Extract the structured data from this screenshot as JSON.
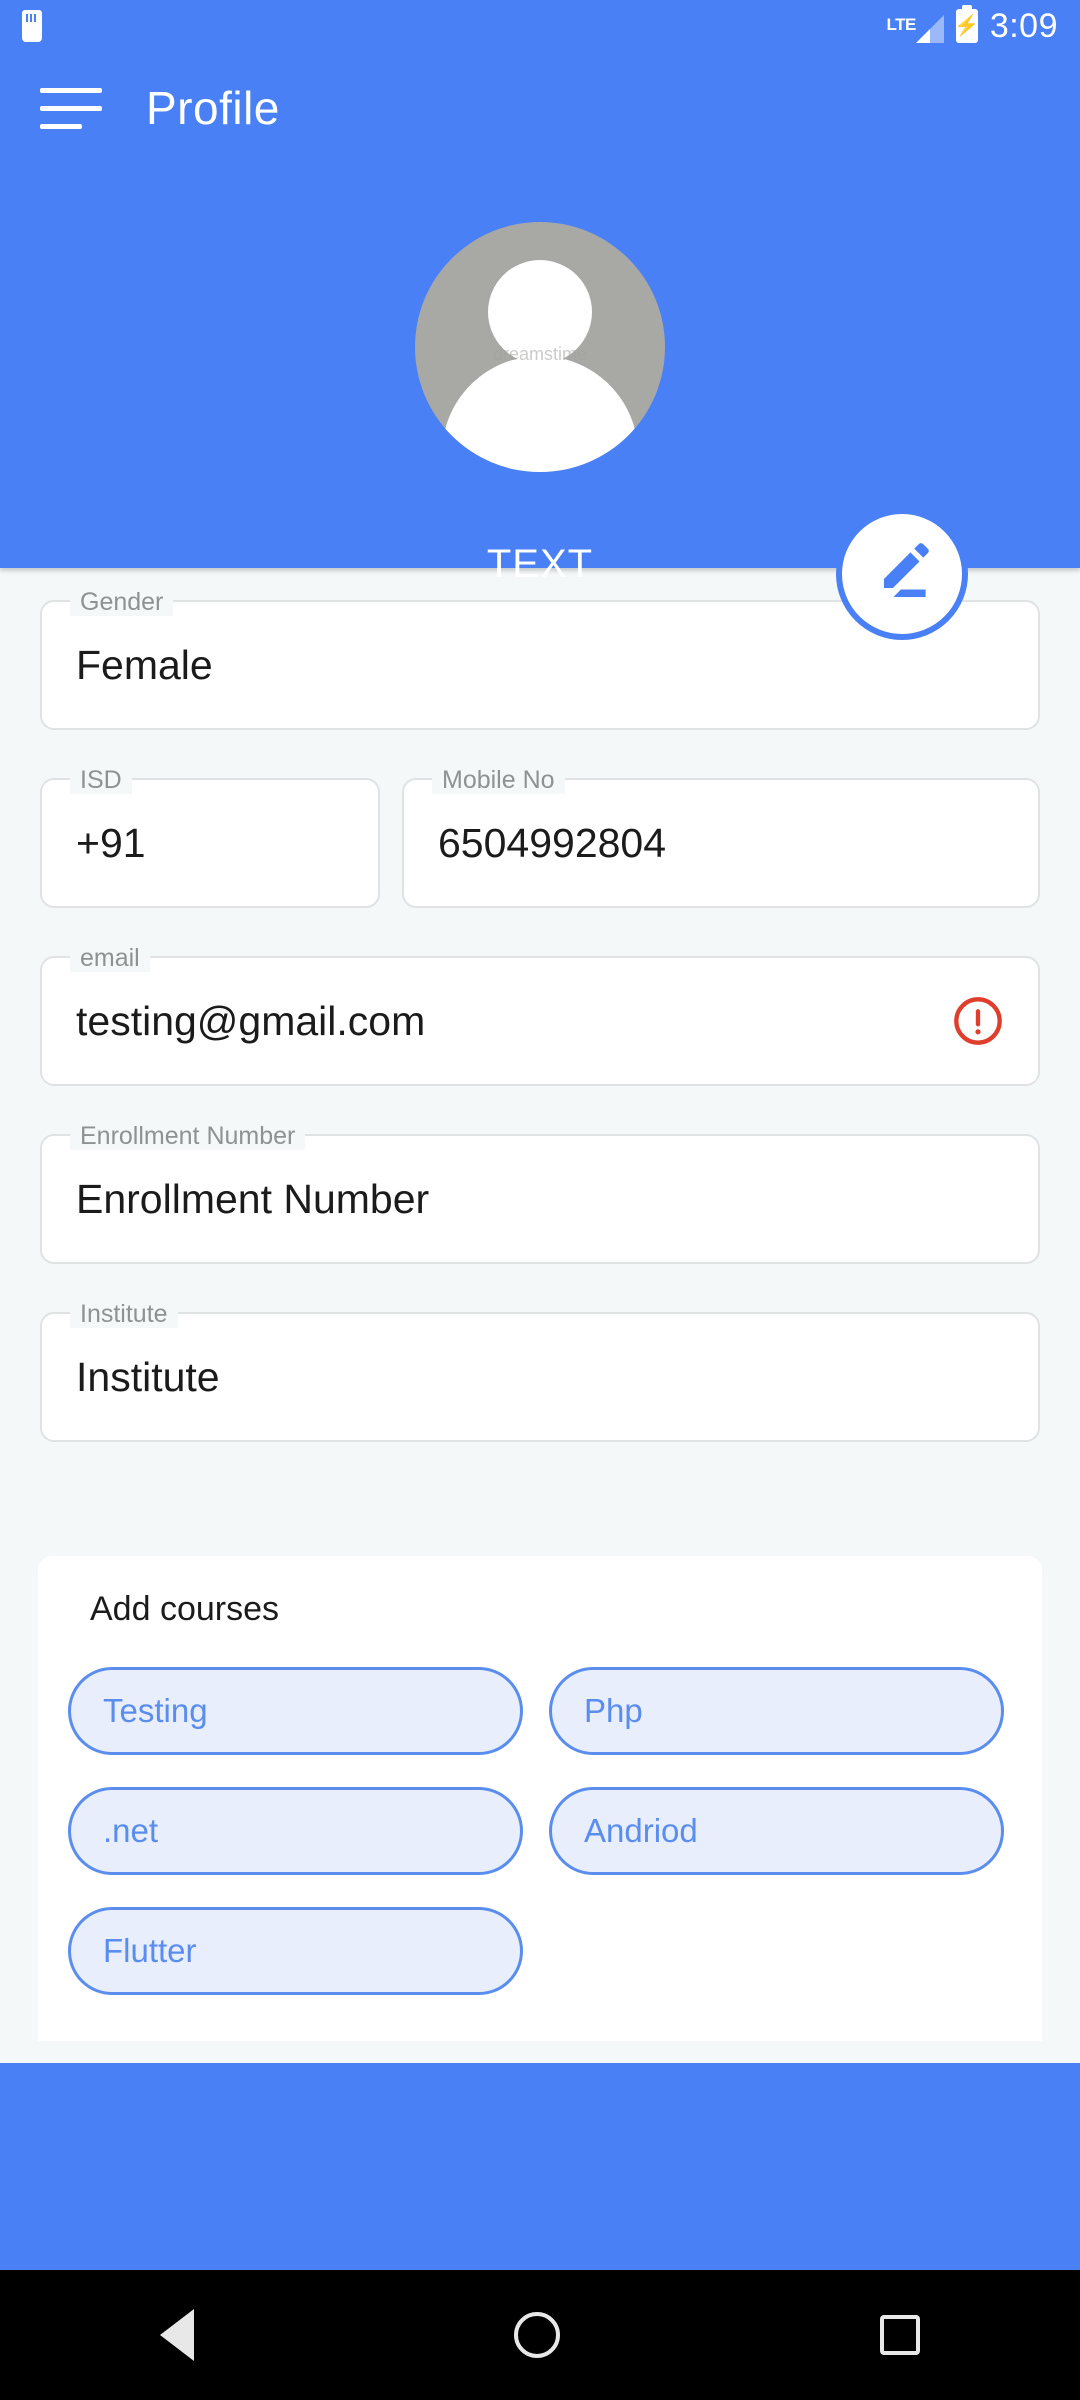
{
  "status_bar": {
    "sd_icon": "sd-card-icon",
    "network_label": "LTE",
    "signal_icon": "signal-bars-icon",
    "battery_icon": "battery-charging-icon",
    "battery_glyph": "⚡",
    "time": "3:09"
  },
  "app_bar": {
    "menu_icon": "hamburger-menu-icon",
    "title": "Profile"
  },
  "profile": {
    "avatar_icon": "avatar-placeholder-icon",
    "avatar_watermark": "dreamstime",
    "name": "TEXT",
    "edit_icon": "edit-pencil-icon"
  },
  "form": {
    "gender": {
      "label": "Gender",
      "value": "Female"
    },
    "isd": {
      "label": "ISD",
      "value": "+91"
    },
    "mobile": {
      "label": "Mobile No",
      "value": "6504992804"
    },
    "email": {
      "label": "email",
      "value": "testing@gmail.com",
      "error_icon": "error-alert-icon"
    },
    "enrollment": {
      "label": "Enrollment Number",
      "value": "Enrollment Number"
    },
    "institute": {
      "label": "Institute",
      "value": "Institute"
    }
  },
  "courses": {
    "title": "Add courses",
    "chips": [
      {
        "label": "Testing"
      },
      {
        "label": "Php"
      },
      {
        "label": ".net"
      },
      {
        "label": "Andriod"
      },
      {
        "label": "Flutter"
      }
    ]
  },
  "nav_bar": {
    "back_icon": "back-triangle-icon",
    "home_icon": "home-circle-icon",
    "recents_icon": "recents-square-icon"
  },
  "colors": {
    "primary_blue": "#4a80f5",
    "chip_border": "#5b8def",
    "chip_fill": "#e8eefc",
    "error_red": "#e03e2d",
    "page_bg": "#f4f8f8"
  }
}
